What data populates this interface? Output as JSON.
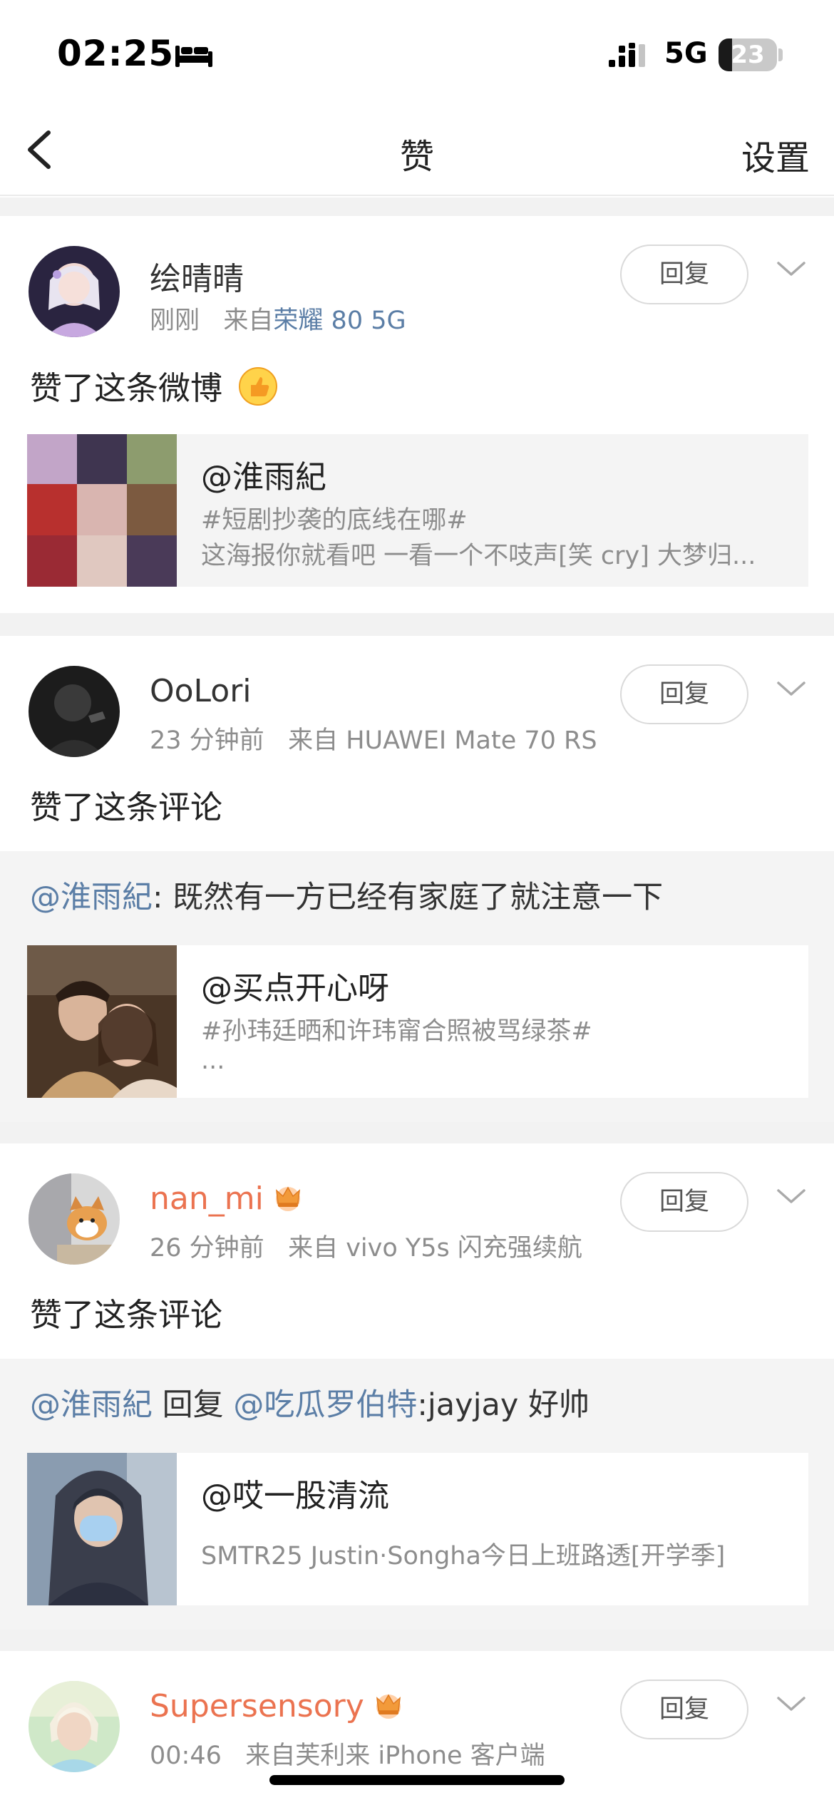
{
  "status_bar": {
    "time": "02:25",
    "network": "5G",
    "battery_level": "23",
    "battery_fraction": 0.23,
    "icons": [
      "bed-icon",
      "signal-icon",
      "battery-icon"
    ]
  },
  "nav": {
    "title": "赞",
    "settings_label": "设置",
    "back_icon": "chevron-left-icon"
  },
  "colors": {
    "link_blue": "#5b7ea6",
    "vip_orange": "#eb7350",
    "gap_gray": "#f2f2f2"
  },
  "notifications": [
    {
      "user": "绘晴晴",
      "time": "刚刚",
      "source_prefix": "来自",
      "source": "荣耀 80 5G",
      "reply_label": "回复",
      "action": "赞了这条微博",
      "post": {
        "author": "@淮雨紀",
        "line1": "#短剧抄袭的底线在哪#",
        "line2": "这海报你就看吧 一看一个不吱声[笑 cry] 大梦归..."
      }
    },
    {
      "user": "OoLori",
      "time": "23 分钟前",
      "source_prefix": "来自",
      "source": "HUAWEI Mate 70 RS",
      "reply_label": "回复",
      "action": "赞了这条评论",
      "comment": {
        "mention": "@淮雨紀",
        "text": ": 既然有一方已经有家庭了就注意一下"
      },
      "post": {
        "author": "@买点开心呀",
        "line1": "#孙玮廷晒和许玮甯合照被骂绿茶#",
        "line2": "..."
      }
    },
    {
      "user": "nan_mi",
      "time": "26 分钟前",
      "source_prefix": "来自",
      "source": "vivo Y5s 闪充强续航",
      "reply_label": "回复",
      "action": "赞了这条评论",
      "comment": {
        "mention": "@淮雨紀",
        "middle": " 回复 ",
        "mention2": "@吃瓜罗伯特",
        "text": ":jayjay 好帅"
      },
      "post": {
        "author": "@哎一股清流",
        "line1": "SMTR25 Justin·Songha今日上班路透[开学季]"
      }
    },
    {
      "user": "Supersensory",
      "time": "00:46",
      "source_prefix": "来自",
      "source": "芙利来 iPhone 客户端",
      "reply_label": "回复"
    }
  ]
}
